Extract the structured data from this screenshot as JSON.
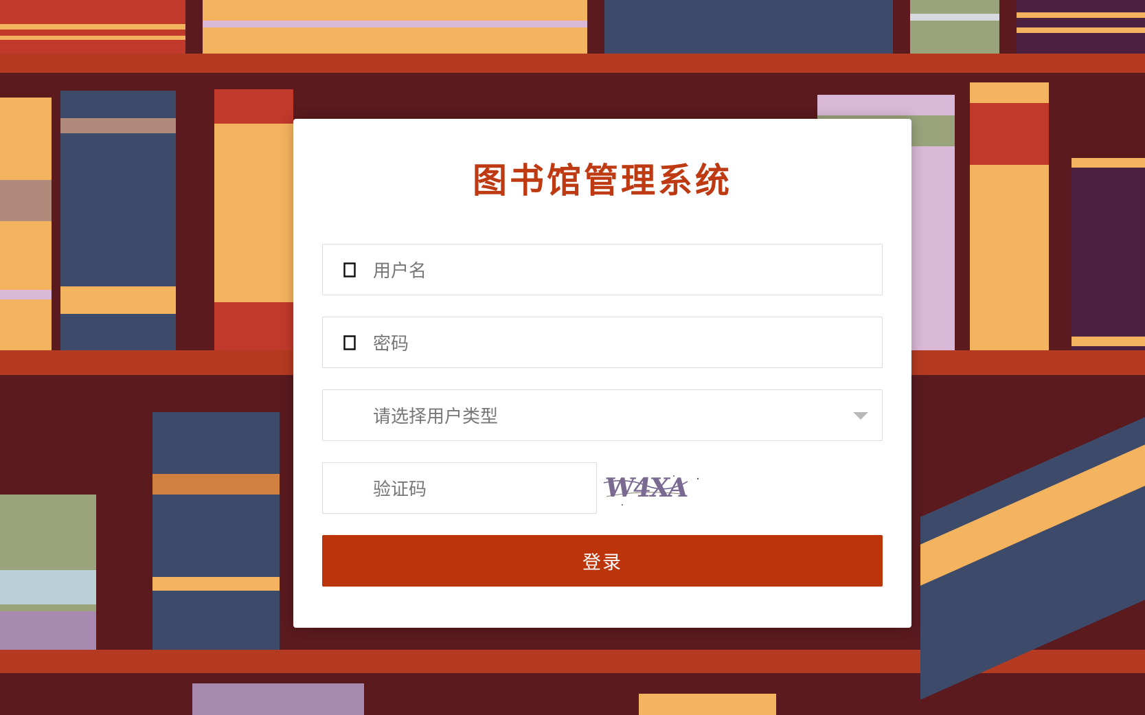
{
  "title": "图书馆管理系统",
  "form": {
    "username_placeholder": "用户名",
    "password_placeholder": "密码",
    "user_type_placeholder": "请选择用户类型",
    "captcha_placeholder": "验证码",
    "captcha_text": "W4XA",
    "login_label": "登录"
  },
  "icons": {
    "username": "user-icon",
    "password": "lock-icon",
    "user_type": "chevron-down-icon"
  },
  "colors": {
    "accent": "#bc3409",
    "title": "#bd3a13",
    "background": "#5a1a1e",
    "shelf": "#b43a22"
  }
}
